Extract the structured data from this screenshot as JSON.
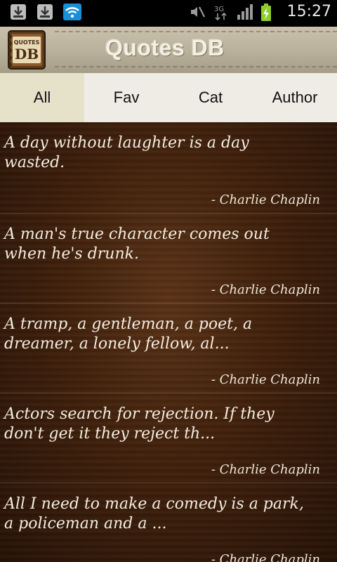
{
  "status_bar": {
    "time": "15:27",
    "icons": [
      "download-icon",
      "download-icon",
      "wifi-icon",
      "mute-icon",
      "3g-icon",
      "signal-icon",
      "battery-charging-icon"
    ],
    "network_label": "3G"
  },
  "header": {
    "title": "Quotes DB",
    "logo_text_top": "QUOTES",
    "logo_text_main": "DB"
  },
  "tabs": [
    {
      "label": "All",
      "active": true
    },
    {
      "label": "Fav",
      "active": false
    },
    {
      "label": "Cat",
      "active": false
    },
    {
      "label": "Author",
      "active": false
    }
  ],
  "quotes": [
    {
      "text": "A day without laughter is a day wasted.",
      "author": "- Charlie Chaplin"
    },
    {
      "text": "A man's true character comes out when he's drunk.",
      "author": "- Charlie Chaplin"
    },
    {
      "text": "A tramp, a gentleman, a poet, a dreamer, a lonely fellow, al...",
      "author": "- Charlie Chaplin"
    },
    {
      "text": "Actors search for rejection. If they don't get it they reject th...",
      "author": "- Charlie Chaplin"
    },
    {
      "text": "All I need to make a comedy is a park, a policeman and a ...",
      "author": "- Charlie Chaplin"
    }
  ],
  "colors": {
    "tab_active_bg": "#e6e2c9",
    "tab_bg": "#efece6",
    "wood_dark": "#261206",
    "quote_text": "#f3ece0"
  }
}
